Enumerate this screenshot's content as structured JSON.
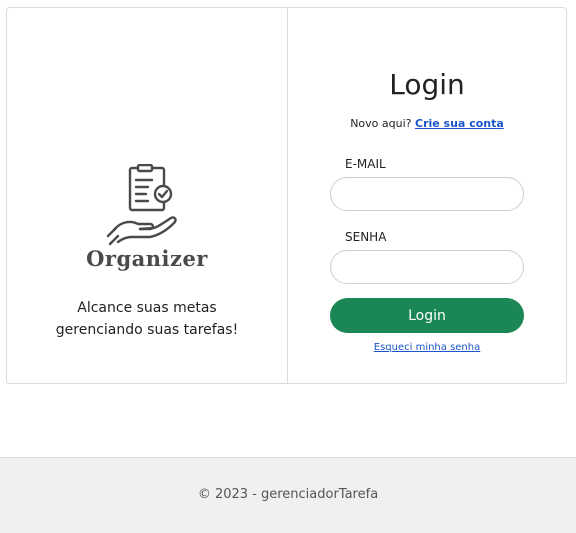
{
  "brand": {
    "logo_text": "Organizer",
    "tagline_line1": "Alcance suas metas",
    "tagline_line2": "gerenciando suas tarefas!"
  },
  "login": {
    "title": "Login",
    "signup_prompt": "Novo aqui?",
    "signup_link": "Crie sua conta",
    "email_label": "E-MAIL",
    "email_value": "",
    "email_placeholder": "",
    "password_label": "SENHA",
    "password_value": "",
    "password_placeholder": "",
    "submit_label": "Login",
    "forgot_link": "Esqueci minha senha"
  },
  "footer": {
    "text": "© 2023 - gerenciadorTarefa"
  },
  "colors": {
    "primary_button": "#1a8754",
    "link": "#1a56c9",
    "footer_bg": "#f0f0f0"
  },
  "icons": {
    "logo": "hand-holding-checklist-icon"
  }
}
